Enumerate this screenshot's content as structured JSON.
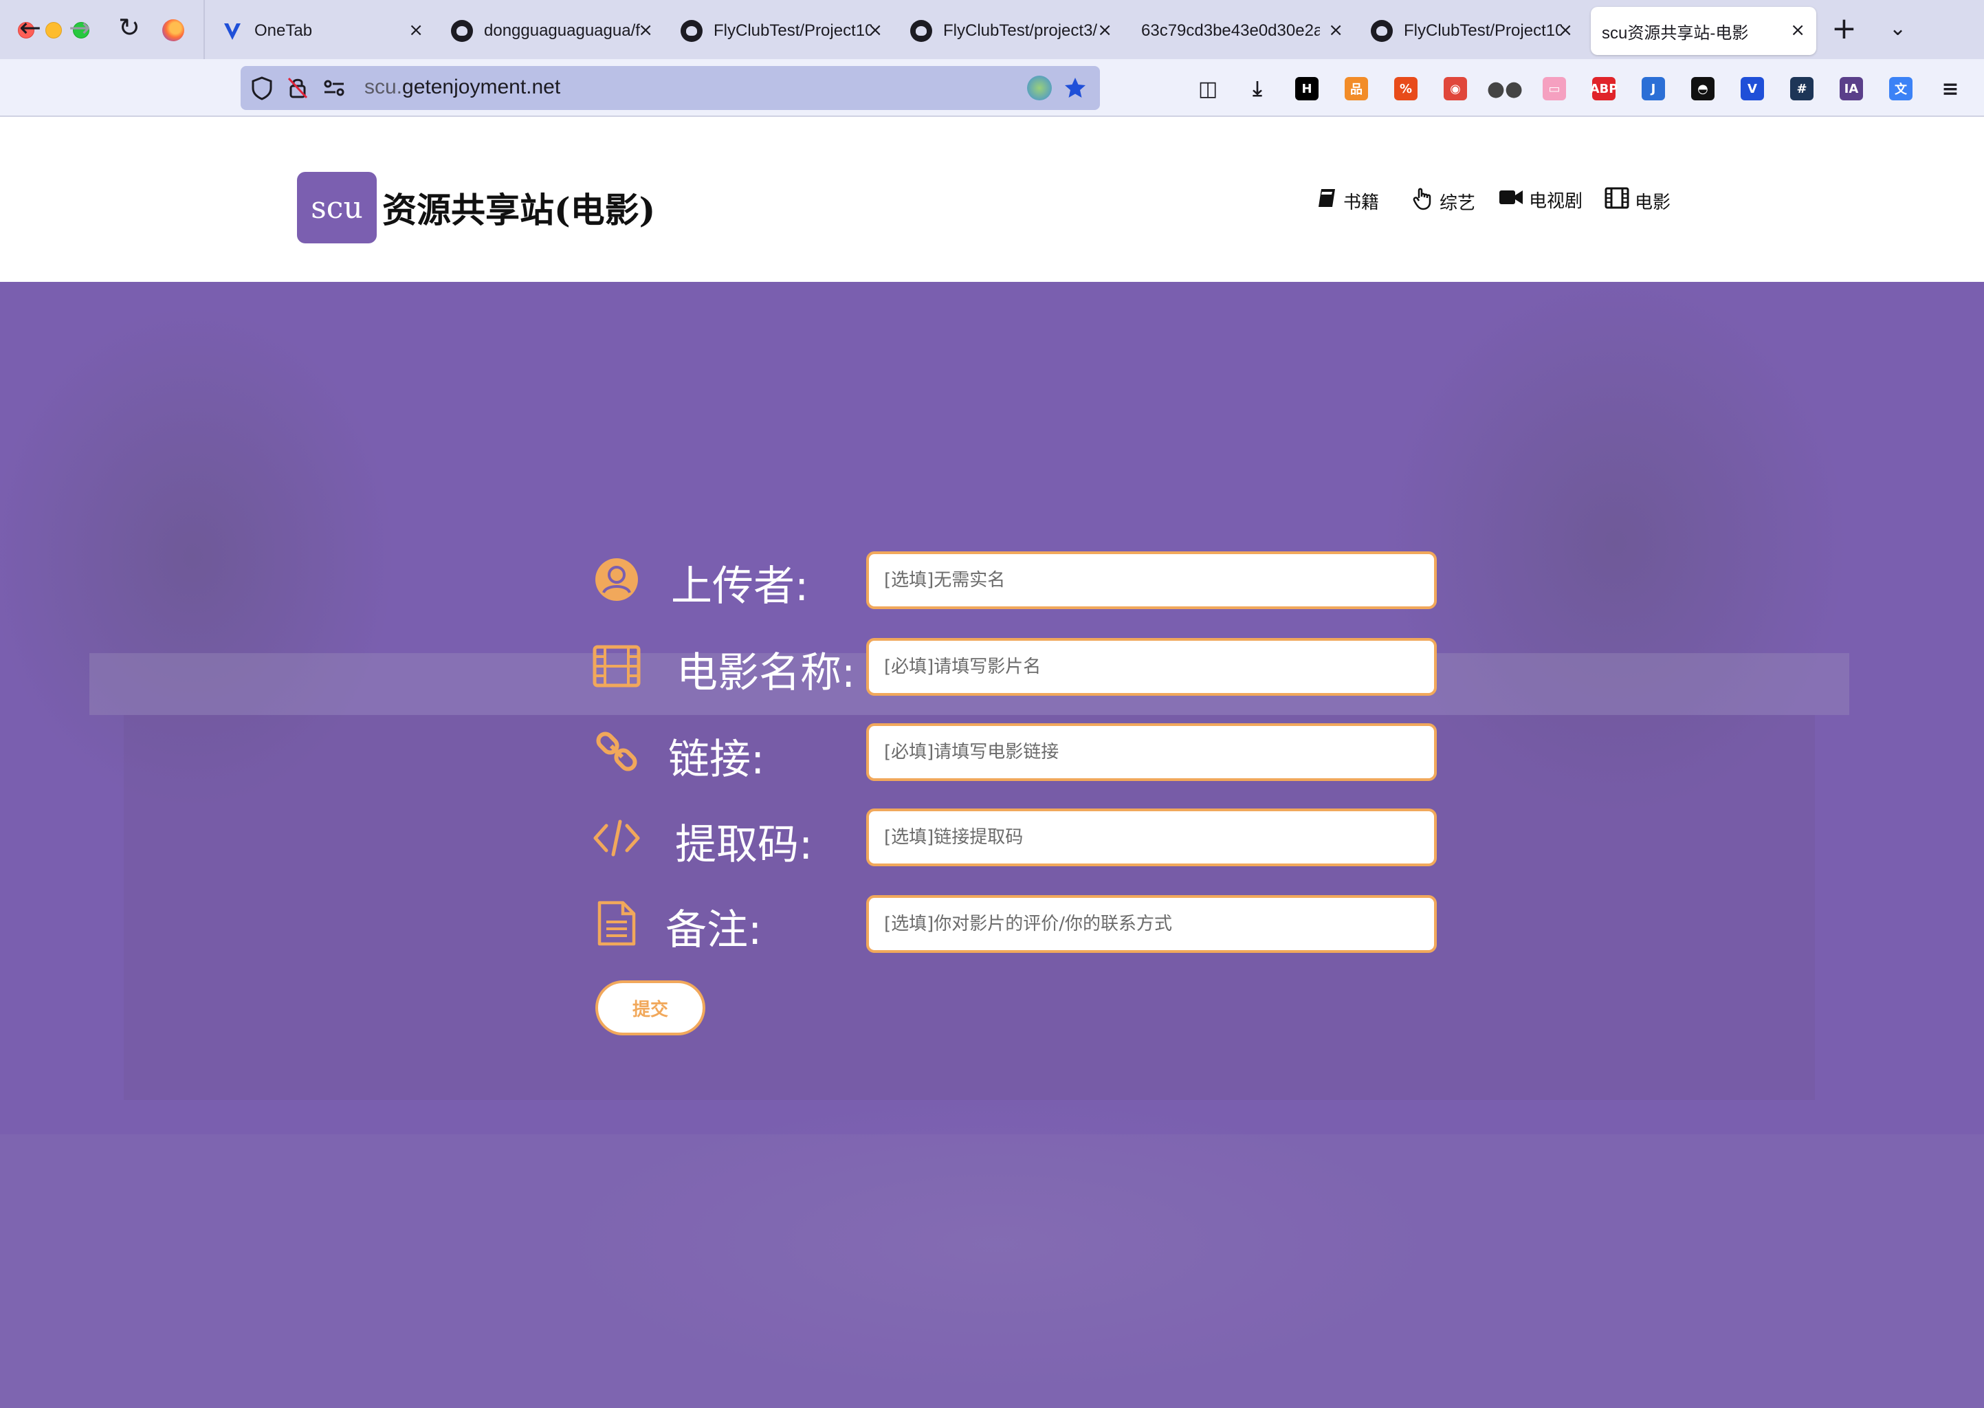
{
  "browser": {
    "tabs": [
      {
        "label": "OneTab",
        "icon": "onetab-icon",
        "close": "×"
      },
      {
        "label": "dongguaguaguagua/f",
        "icon": "github-icon",
        "close": "×"
      },
      {
        "label": "FlyClubTest/Project10",
        "icon": "github-icon",
        "close": "×"
      },
      {
        "label": "FlyClubTest/project3/",
        "icon": "github-icon",
        "close": "×"
      },
      {
        "label": "63c79cd3be43e0d30e2a",
        "icon": "",
        "close": "×"
      },
      {
        "label": "FlyClubTest/Project10",
        "icon": "github-icon",
        "close": "×"
      },
      {
        "label": "scu资源共享站-电影",
        "icon": "",
        "close": "×",
        "active": true
      }
    ],
    "new_tab": "+",
    "tab_list": "⌄",
    "url": {
      "host_prefix": "scu.",
      "host": "getenjoyment.net"
    },
    "extensions": [
      {
        "name": "pocket-icon",
        "text": "◫",
        "color": "#1c1b22"
      },
      {
        "name": "download-icon",
        "text": "⤓",
        "color": "#1c1b22"
      },
      {
        "name": "h-extension-icon",
        "text": "H",
        "color": "#000000"
      },
      {
        "name": "hierarchy-icon",
        "text": "品",
        "color": "#f28c28"
      },
      {
        "name": "zotero-icon",
        "text": "%",
        "color": "#e84b1a"
      },
      {
        "name": "screenshot-icon",
        "text": "◉",
        "color": "#e0473b"
      },
      {
        "name": "glasses-icon",
        "text": "●●",
        "color": "#444444"
      },
      {
        "name": "bilibili-icon",
        "text": "▭",
        "color": "#f5a0c0"
      },
      {
        "name": "adblock-icon",
        "text": "ABP",
        "color": "#e0242a"
      },
      {
        "name": "j-extension-icon",
        "text": "J",
        "color": "#2b6fd6"
      },
      {
        "name": "tampermonkey-icon",
        "text": "◓",
        "color": "#111111"
      },
      {
        "name": "v-extension-icon",
        "text": "V",
        "color": "#1f4fd8"
      },
      {
        "name": "hashtag-icon",
        "text": "#",
        "color": "#1d3557"
      },
      {
        "name": "ia-icon",
        "text": "IA",
        "color": "#5a3f8a"
      },
      {
        "name": "translate-icon",
        "text": "文",
        "color": "#3b82f6"
      },
      {
        "name": "menu-icon",
        "text": "≡",
        "color": "#1c1b22"
      }
    ]
  },
  "header": {
    "logo_text": "scu",
    "title": "资源共享站(电影)",
    "nav": [
      {
        "label": "书籍",
        "icon": "book-icon"
      },
      {
        "label": "综艺",
        "icon": "hand-pointer-icon"
      },
      {
        "label": "电视剧",
        "icon": "video-camera-icon"
      },
      {
        "label": "电影",
        "icon": "film-icon"
      }
    ]
  },
  "form": {
    "uploader": {
      "label": "上传者:",
      "placeholder": "[选填]无需实名"
    },
    "movie_name": {
      "label": "电影名称:",
      "placeholder": "[必填]请填写影片名"
    },
    "link": {
      "label": "链接:",
      "placeholder": "[必填]请填写电影链接"
    },
    "code": {
      "label": "提取码:",
      "placeholder": "[选填]链接提取码"
    },
    "note": {
      "label": "备注:",
      "placeholder": "[选填]你对影片的评价/你的联系方式"
    },
    "submit": "提交"
  },
  "colors": {
    "accent": "#f1a85b",
    "brand": "#7b5fb0",
    "hero_bg": "#7a5faf"
  }
}
